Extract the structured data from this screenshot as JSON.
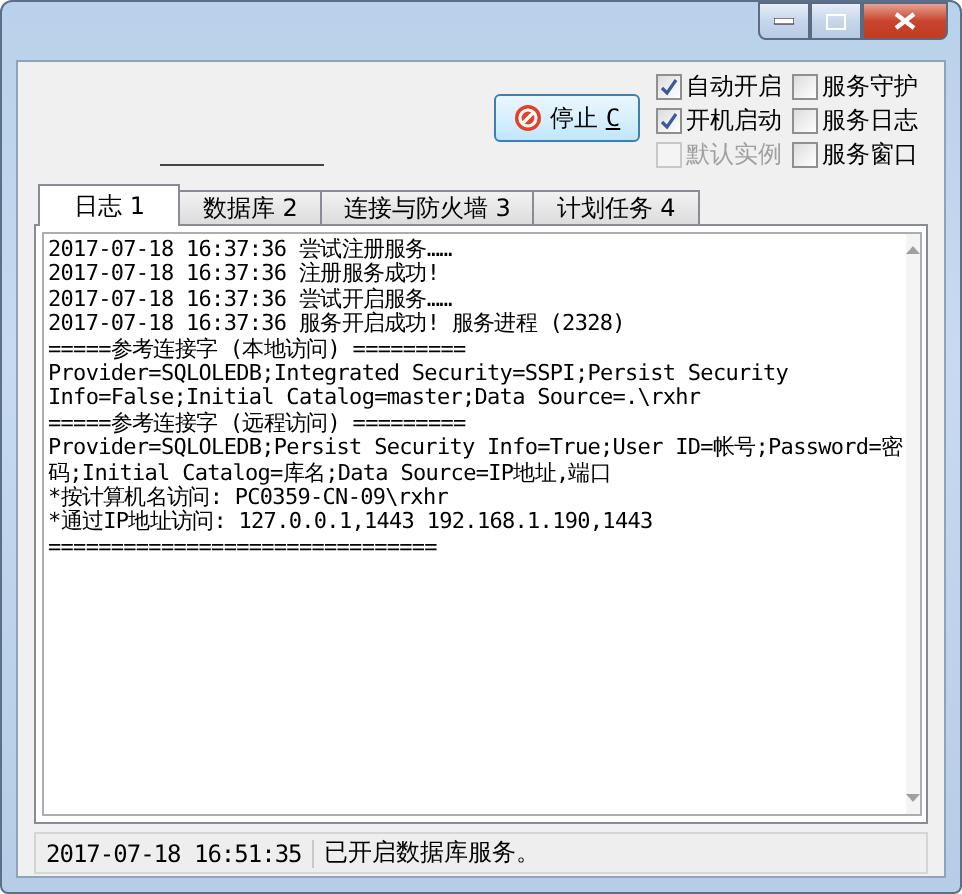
{
  "stop_button": {
    "label": "停止",
    "accelerator": "C"
  },
  "options": [
    {
      "label": "自动开启",
      "checked": true,
      "disabled": false
    },
    {
      "label": "服务守护",
      "checked": false,
      "disabled": false
    },
    {
      "label": "开机启动",
      "checked": true,
      "disabled": false
    },
    {
      "label": "服务日志",
      "checked": false,
      "disabled": false
    },
    {
      "label": "默认实例",
      "checked": false,
      "disabled": true
    },
    {
      "label": "服务窗口",
      "checked": false,
      "disabled": false
    }
  ],
  "tabs": [
    {
      "label": "日志 1",
      "selected": true
    },
    {
      "label": "数据库 2",
      "selected": false
    },
    {
      "label": "连接与防火墙 3",
      "selected": false
    },
    {
      "label": "计划任务 4",
      "selected": false
    }
  ],
  "log_lines": [
    "2017-07-18 16:37:36 尝试注册服务……",
    "2017-07-18 16:37:36 注册服务成功!",
    "2017-07-18 16:37:36 尝试开启服务……",
    "2017-07-18 16:37:36 服务开启成功! 服务进程 (2328)",
    "=====参考连接字 (本地访问) =========",
    "Provider=SQLOLEDB;Integrated Security=SSPI;Persist Security",
    "Info=False;Initial Catalog=master;Data Source=.\\rxhr",
    "=====参考连接字 (远程访问) =========",
    "Provider=SQLOLEDB;Persist Security Info=True;User ID=帐号;Password=密",
    "码;Initial Catalog=库名;Data Source=IP地址,端口",
    "*按计算机名访问: PC0359-CN-09\\rxhr",
    "*通过IP地址访问: 127.0.0.1,1443 192.168.1.190,1443",
    "==============================="
  ],
  "status_bar": {
    "time": "2017-07-18 16:51:35",
    "message": "已开启数据库服务。"
  }
}
